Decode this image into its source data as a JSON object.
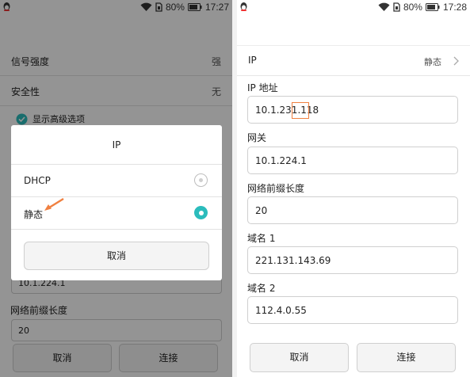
{
  "left": {
    "status": {
      "battery": "80%",
      "time": "17:27"
    },
    "signal_label": "信号强度",
    "signal_value": "强",
    "security_label": "安全性",
    "security_value": "无",
    "advanced_label": "显示高级选项",
    "gateway_partial": "10.1.224.1",
    "prefix_label": "网络前缀长度",
    "prefix_partial": "20",
    "cancel_label": "取消",
    "connect_label": "连接",
    "dialog": {
      "title": "IP",
      "option_dhcp": "DHCP",
      "option_static": "静态",
      "selected": "静态",
      "cancel_label": "取消"
    }
  },
  "right": {
    "status": {
      "battery": "80%",
      "time": "17:28"
    },
    "ip_label": "IP",
    "ip_value": "静态",
    "ip_address_label": "IP 地址",
    "ip_address_value": "10.1.231.118",
    "gateway_label": "网关",
    "gateway_value": "10.1.224.1",
    "prefix_label": "网络前缀长度",
    "prefix_value": "20",
    "dns1_label": "域名 1",
    "dns1_value": "221.131.143.69",
    "dns2_label": "域名 2",
    "dns2_value": "112.4.0.55",
    "cancel_label": "取消",
    "connect_label": "连接"
  },
  "colors": {
    "accent": "#2bbcbc",
    "annotation": "#f08040"
  },
  "icons": [
    "qq-icon",
    "wifi-icon",
    "sim-icon",
    "battery-icon",
    "chevron-right-icon",
    "checkbox-checked-icon",
    "annotation-arrow-icon"
  ]
}
